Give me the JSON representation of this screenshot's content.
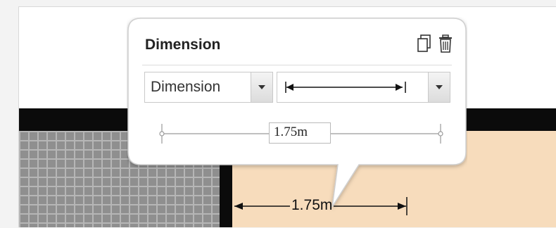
{
  "popover": {
    "title": "Dimension",
    "type_select": {
      "value": "Dimension"
    },
    "arrow_style_select": {
      "value": "|←→|"
    },
    "measurement": "1.75m"
  },
  "floorplan": {
    "dimension_label": "1.75m"
  },
  "icons": {
    "duplicate": "duplicate-icon",
    "delete": "trash-icon",
    "dropdown": "chevron-down-icon"
  },
  "colors": {
    "wall": "#0b0b0b",
    "wood_floor": "#f7dcbc",
    "tile_floor": "#8f8f8f"
  }
}
